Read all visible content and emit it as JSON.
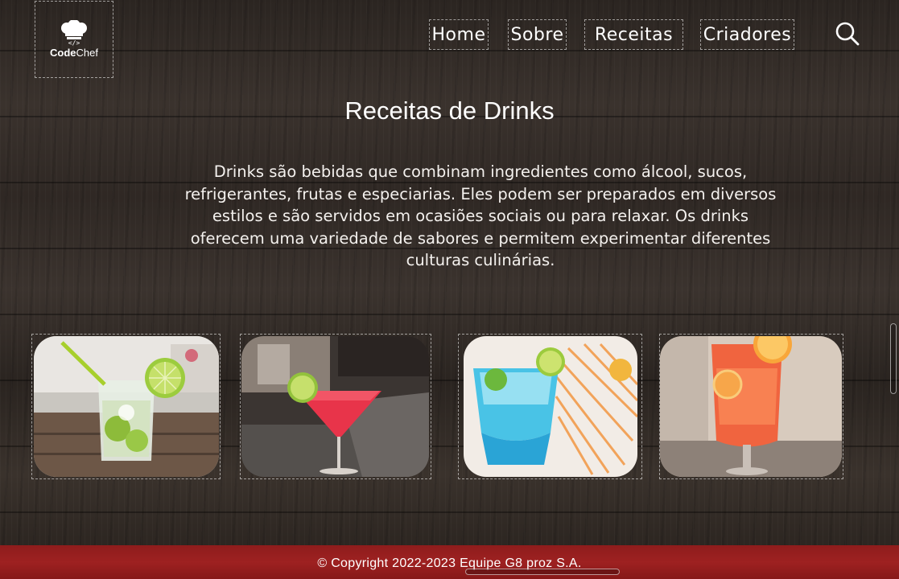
{
  "header": {
    "logo": {
      "brand_bold": "Code",
      "brand_light": "Chef",
      "icon": "chef-hat-icon"
    },
    "nav": [
      {
        "label": "Home"
      },
      {
        "label": "Sobre"
      },
      {
        "label": "Receitas"
      },
      {
        "label": "Criadores"
      }
    ],
    "search_icon": "search-icon"
  },
  "main": {
    "title": "Receitas de Drinks",
    "intro_lines": [
      "Drinks são bebidas que combinam ingredientes como álcool, sucos,",
      "refrigerantes, frutas e especiarias. Eles podem ser preparados em diversos",
      "estilos e são servidos em ocasiões sociais ou para relaxar. Os drinks",
      "oferecem uma variedade de sabores e permitem experimentar diferentes",
      "culturas culinárias."
    ],
    "cards": [
      {
        "drink": "caipirinha with lime"
      },
      {
        "drink": "red cocktail in martini glass with lime"
      },
      {
        "drink": "blue lagoon cocktail"
      },
      {
        "drink": "orange spritz with orange slice"
      }
    ]
  },
  "footer": {
    "text": "© Copyright 2022-2023 Equipe G8 proz S.A."
  },
  "colors": {
    "footer_bg": "#9e2121",
    "wood_dark": "#2b2521",
    "text": "#ffffff"
  }
}
